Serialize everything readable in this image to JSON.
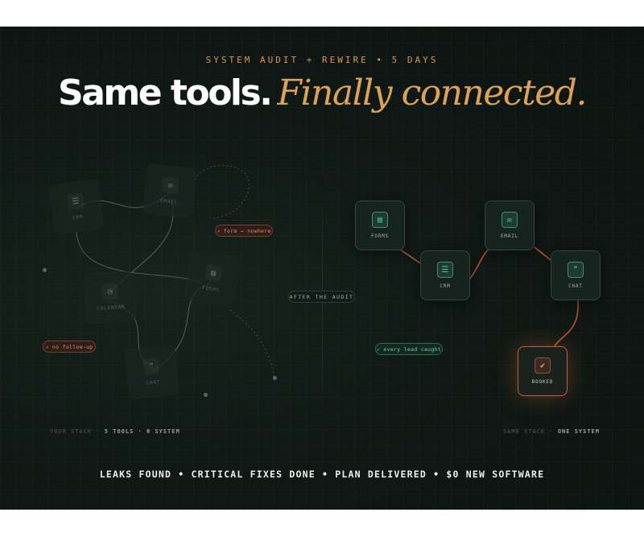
{
  "header": {
    "eyebrow": "SYSTEM AUDIT + REWIRE • 5 DAYS",
    "headline_main": "Same tools.",
    "headline_accent": "Finally connected."
  },
  "colors": {
    "accent_orange": "#dda259",
    "accent_green": "#57c79d",
    "warning_red": "#e08a6c",
    "background": "#101915"
  },
  "left": {
    "nodes": [
      {
        "label": "CRM",
        "icon": "list-icon",
        "glyph": "☰"
      },
      {
        "label": "EMAIL",
        "icon": "mail-icon",
        "glyph": "✉"
      },
      {
        "label": "CALENDAR",
        "icon": "clock-icon",
        "glyph": "◷"
      },
      {
        "label": "FORMS",
        "icon": "form-icon",
        "glyph": "▤"
      },
      {
        "label": "CHAT",
        "icon": "quote-icon",
        "glyph": "❞"
      }
    ],
    "warnings": [
      "↗ form → nowhere",
      "↗ no follow-up"
    ],
    "caption_prefix": "YOUR STACK · ",
    "caption_bold": "5 TOOLS · 0 SYSTEM"
  },
  "middle": {
    "label": "AFTER THE AUDIT"
  },
  "right": {
    "nodes": [
      {
        "label": "FORMS",
        "icon": "form-icon",
        "glyph": "▤"
      },
      {
        "label": "CRM",
        "icon": "list-icon",
        "glyph": "☰"
      },
      {
        "label": "EMAIL",
        "icon": "mail-icon",
        "glyph": "✉"
      },
      {
        "label": "CHAT",
        "icon": "quote-icon",
        "glyph": "❞"
      },
      {
        "label": "BOOKED",
        "icon": "check-icon",
        "glyph": "✔"
      }
    ],
    "success": "✓ every lead caught",
    "caption_prefix": "SAME STACK · ",
    "caption_bold": "ONE SYSTEM"
  },
  "tagline": "LEAKS FOUND • CRITICAL FIXES DONE • PLAN DELIVERED • $0 NEW SOFTWARE"
}
